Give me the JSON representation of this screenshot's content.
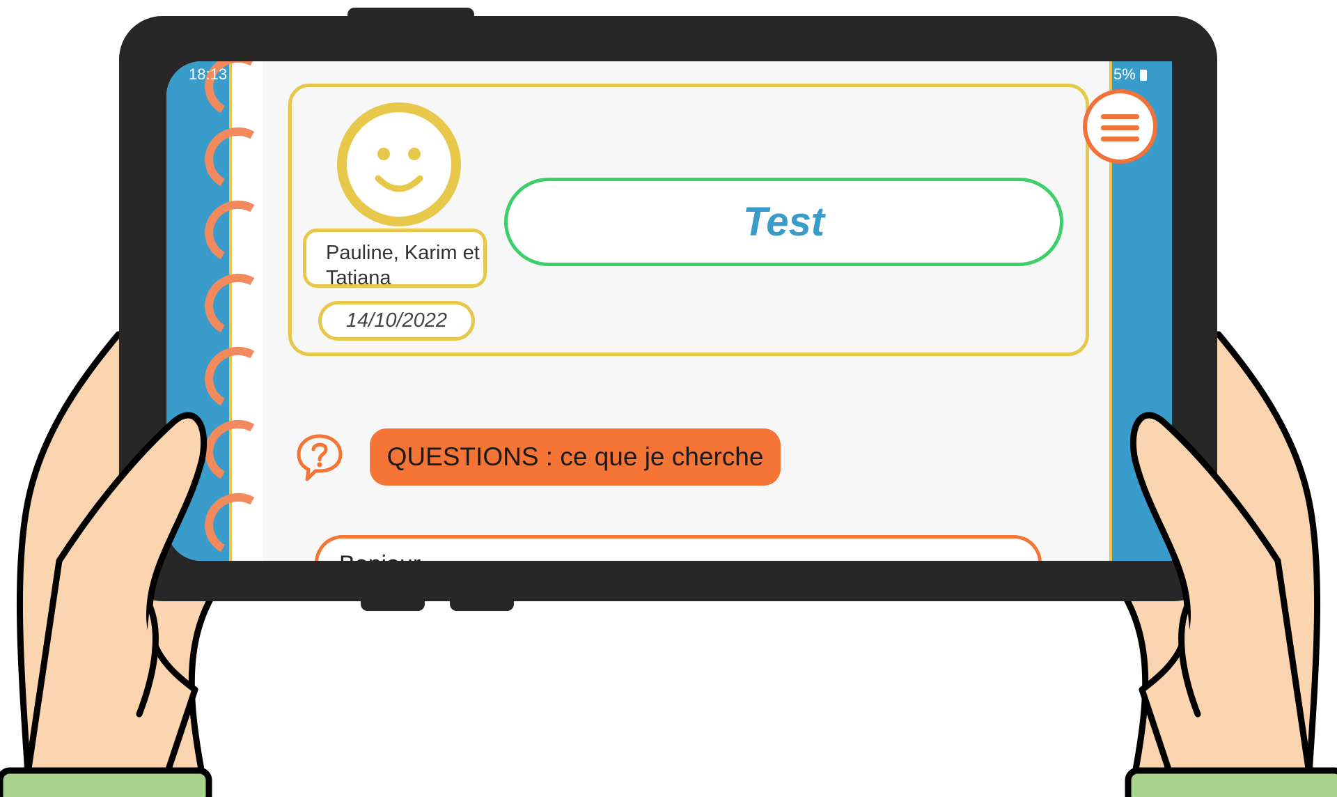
{
  "status_bar": {
    "time": "18:13",
    "battery": "5%"
  },
  "header": {
    "authors": "Pauline, Karim et Tatiana",
    "date": "14/10/2022",
    "title": "Test"
  },
  "section": {
    "label": "QUESTIONS : ce que je cherche"
  },
  "answer": {
    "text": "Bonjour"
  },
  "colors": {
    "accent_blue": "#3a9ccb",
    "accent_yellow": "#e8c84a",
    "accent_orange": "#f47536",
    "accent_green": "#3fcf6a"
  },
  "icons": [
    "smiley-avatar-icon",
    "hamburger-menu-icon",
    "question-bubble-icon",
    "battery-icon"
  ]
}
